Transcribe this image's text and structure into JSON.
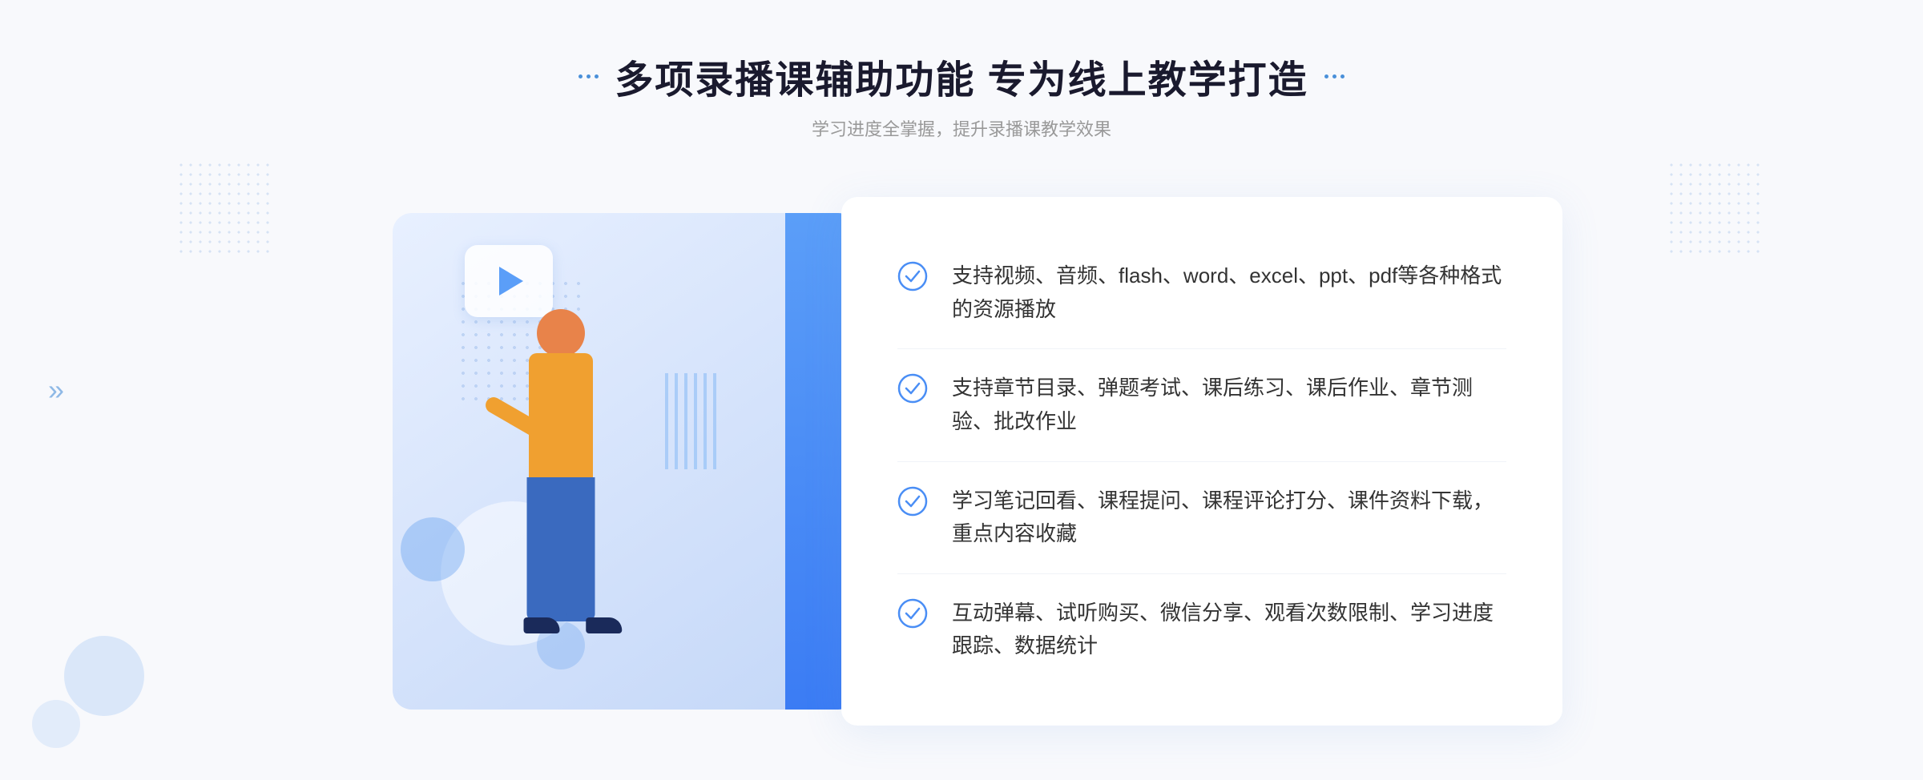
{
  "header": {
    "title": "多项录播课辅助功能 专为线上教学打造",
    "subtitle": "学习进度全掌握，提升录播课教学效果"
  },
  "features": [
    {
      "id": "feature-1",
      "text": "支持视频、音频、flash、word、excel、ppt、pdf等各种格式的资源播放"
    },
    {
      "id": "feature-2",
      "text": "支持章节目录、弹题考试、课后练习、课后作业、章节测验、批改作业"
    },
    {
      "id": "feature-3",
      "text": "学习笔记回看、课程提问、课程评论打分、课件资料下载，重点内容收藏"
    },
    {
      "id": "feature-4",
      "text": "互动弹幕、试听购买、微信分享、观看次数限制、学习进度跟踪、数据统计"
    }
  ],
  "decorators": {
    "left_dots": "⠿",
    "right_dots": "⠿",
    "chevron": "»"
  },
  "colors": {
    "primary": "#4a8ef5",
    "title": "#1a1a2e",
    "text": "#333333",
    "subtitle": "#999999",
    "check": "#4a8ef5"
  }
}
